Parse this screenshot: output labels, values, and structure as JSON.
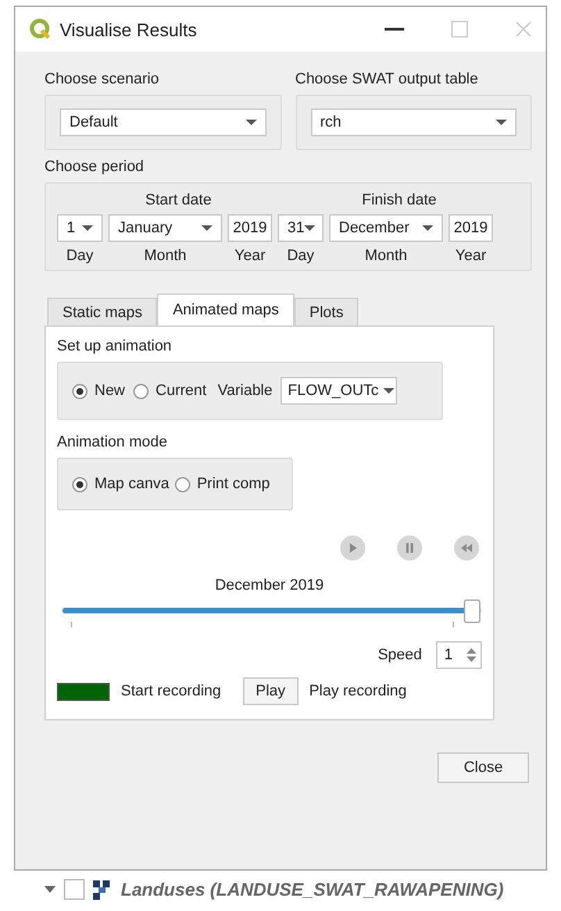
{
  "window": {
    "title": "Visualise Results"
  },
  "scenario": {
    "label": "Choose scenario",
    "value": "Default"
  },
  "output_table": {
    "label": "Choose SWAT output table",
    "value": "rch"
  },
  "period": {
    "label": "Choose period",
    "dates": [
      {
        "heading": "Start date",
        "day": "1",
        "month": "January",
        "year": "2019",
        "day_label": "Day",
        "month_label": "Month",
        "year_label": "Year"
      },
      {
        "heading": "Finish date",
        "day": "31",
        "month": "December",
        "year": "2019",
        "day_label": "Day",
        "month_label": "Month",
        "year_label": "Year"
      }
    ]
  },
  "tabs": [
    {
      "label": "Static maps",
      "selected": false
    },
    {
      "label": "Animated maps",
      "selected": true
    },
    {
      "label": "Plots",
      "selected": false
    }
  ],
  "animation": {
    "setup_label": "Set up animation",
    "setup_options": [
      {
        "label": "New",
        "selected": true
      },
      {
        "label": "Current",
        "selected": false
      }
    ],
    "variable_label": "Variable",
    "variable_value": "FLOW_OUTc",
    "mode_label": "Animation mode",
    "mode_options": [
      {
        "label": "Map canva",
        "selected": true
      },
      {
        "label": "Print comp",
        "selected": false
      }
    ],
    "date": "December 2019",
    "level": 0.985,
    "speed_label": "Speed",
    "speed_value": "1",
    "record_label": "Start recording",
    "play_button": "Play",
    "play_label": "Play recording"
  },
  "close_button": "Close",
  "layers": [
    {
      "label": "Landuses (LANDUSE_SWAT_RAWAPENING)",
      "expanded": true,
      "checked": false
    }
  ]
}
